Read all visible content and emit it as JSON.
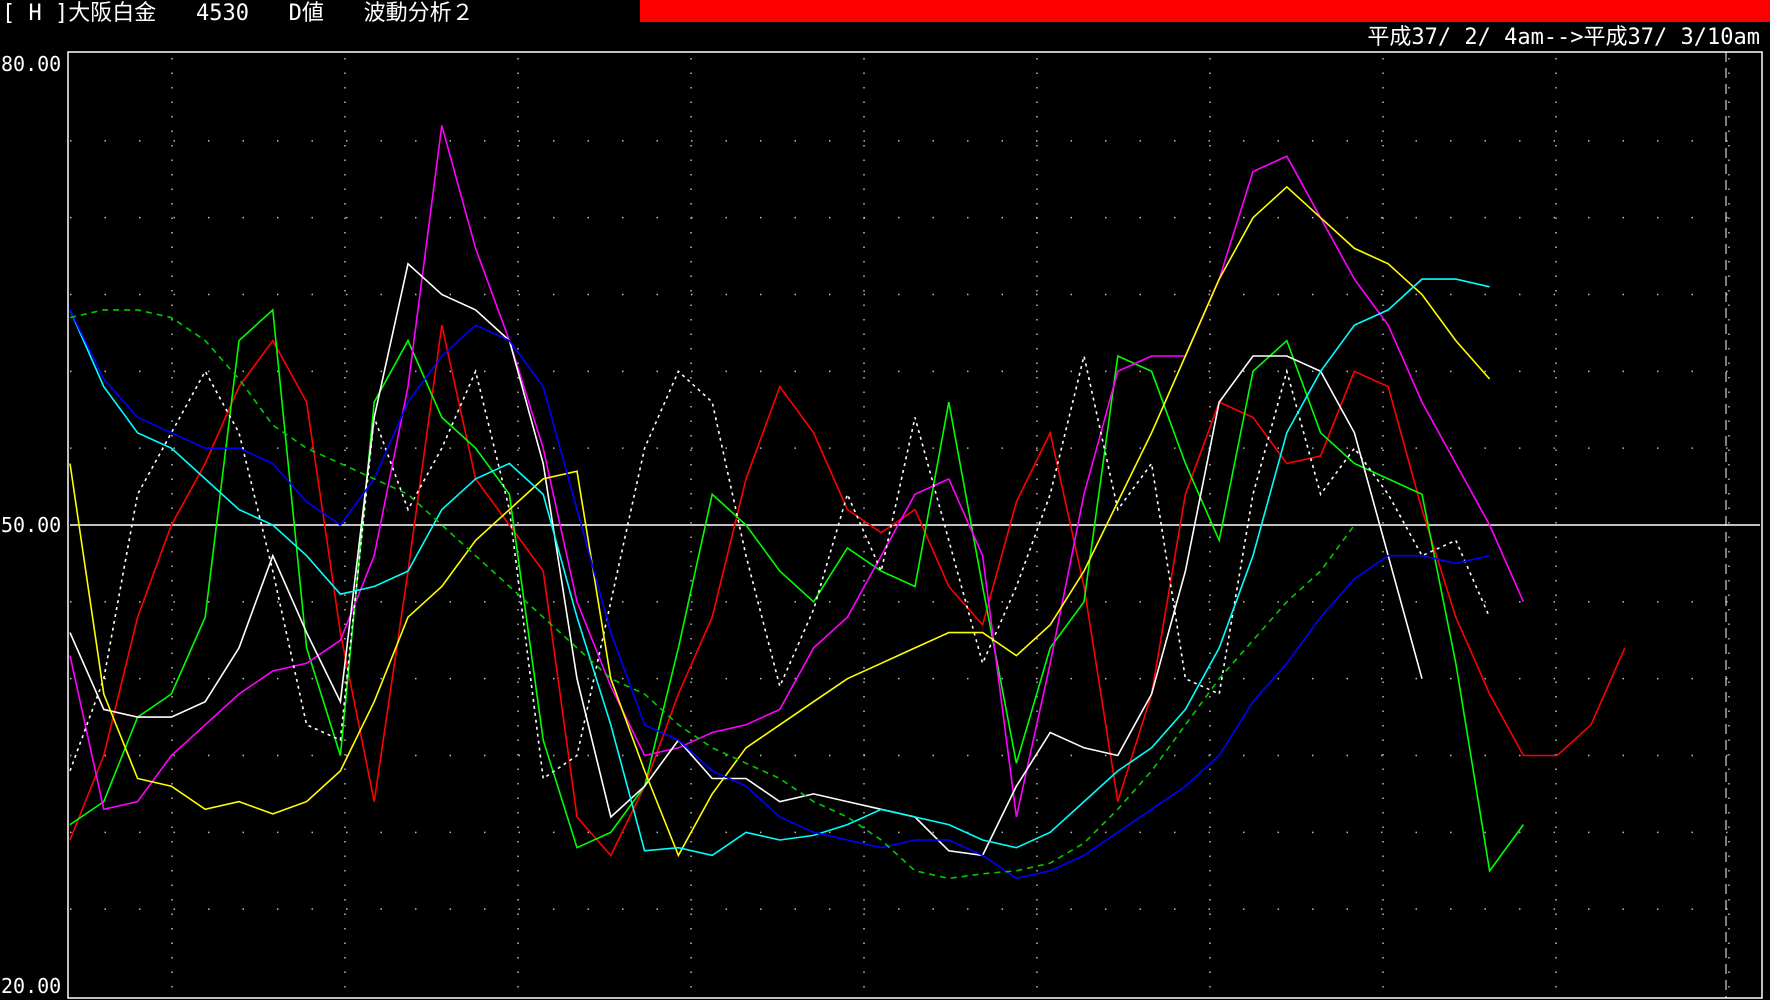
{
  "header": {
    "title": "[ H ]大阪白金   4530   D値   波動分析２",
    "date_range": "平成37/ 2/ 4am-->平成37/ 3/10am",
    "progress_color": "#ff0000"
  },
  "chart_data": {
    "type": "line",
    "title": "",
    "xlabel": "",
    "ylabel": "",
    "ylim": [
      20,
      80
    ],
    "yticks": [
      "80.00",
      "50.00",
      "20.00"
    ],
    "reference_line": 50,
    "grid": true,
    "x": [
      1,
      2,
      3,
      4,
      5,
      6,
      7,
      8,
      9,
      10,
      11,
      12,
      13,
      14,
      15,
      16,
      17,
      18,
      19,
      20,
      21,
      22,
      23,
      24,
      25,
      26,
      27,
      28,
      29,
      30,
      31,
      32,
      33,
      34,
      35,
      36,
      37,
      38,
      39,
      40,
      41,
      42,
      43,
      44,
      45,
      46,
      47,
      48,
      49,
      50,
      51
    ],
    "series": [
      {
        "color": "#ff0000",
        "style": "solid",
        "values": [
          29.5,
          35,
          44,
          50,
          54,
          59,
          62,
          58,
          43,
          32,
          47,
          63,
          53,
          50,
          47,
          31,
          28.5,
          33,
          39,
          44,
          53,
          59,
          56,
          51,
          49.5,
          51,
          46,
          43.5,
          51.5,
          56,
          46,
          32,
          39,
          52,
          58,
          57,
          54,
          54.5,
          60,
          59,
          51,
          44,
          39,
          35,
          35,
          37,
          42,
          null,
          null,
          null,
          null
        ]
      },
      {
        "color": "#00ff00",
        "style": "solid",
        "values": [
          30.5,
          32,
          37.5,
          39,
          44,
          62,
          64,
          42,
          35,
          58,
          62,
          57,
          55,
          52,
          36,
          29,
          30,
          33,
          42,
          52,
          50,
          47,
          45,
          48.5,
          47,
          46,
          58,
          46,
          34.5,
          42,
          45,
          61,
          60,
          54,
          49,
          60,
          62,
          56,
          54,
          53,
          52,
          41,
          27.5,
          30.5,
          null,
          null,
          null,
          null,
          null,
          null,
          null
        ]
      },
      {
        "color": "#ff00ff",
        "style": "solid",
        "values": [
          41.5,
          31.5,
          32,
          35,
          37,
          39,
          40.5,
          41,
          42.5,
          48,
          59,
          76,
          68,
          62,
          55,
          45,
          39.5,
          35,
          35.5,
          36.5,
          37,
          38,
          42,
          44,
          48,
          52,
          53,
          48,
          31,
          41,
          52,
          60,
          61,
          61,
          66,
          73,
          74,
          70,
          66,
          63,
          58,
          54,
          50,
          45,
          null,
          null,
          null,
          null,
          null,
          null,
          null
        ]
      },
      {
        "color": "#ffffff",
        "style": "solid",
        "values": [
          43,
          38,
          37.5,
          37.5,
          38.5,
          42,
          48,
          43,
          38.5,
          57,
          67,
          65,
          64,
          62,
          54,
          40,
          31,
          33,
          36,
          33.5,
          33.5,
          32,
          32.5,
          32,
          31.5,
          31,
          28.8,
          28.5,
          33,
          36.5,
          35.5,
          35,
          39,
          47,
          58,
          61,
          61,
          60,
          56,
          48,
          40,
          null,
          null,
          null,
          null,
          null,
          null,
          null,
          null,
          null,
          null
        ]
      },
      {
        "color": "#ffffff",
        "style": "dotted",
        "values": [
          34,
          40,
          52,
          56,
          60,
          56,
          47,
          37,
          36,
          57,
          51,
          55,
          60,
          51,
          33.5,
          35,
          45,
          55,
          60,
          58,
          48,
          39.5,
          44.5,
          52,
          47,
          57,
          49,
          41,
          46,
          52,
          61,
          51,
          54,
          40,
          39,
          52,
          60,
          52,
          55,
          52,
          48,
          49,
          44,
          null,
          null,
          null,
          null,
          null,
          null,
          null,
          null
        ]
      },
      {
        "color": "#ffff00",
        "style": "solid",
        "values": [
          54,
          39,
          33.5,
          33,
          31.5,
          32,
          31.2,
          32,
          34,
          38.5,
          44,
          46,
          49,
          51,
          53,
          53.5,
          40,
          34,
          28.5,
          32.5,
          35.5,
          37,
          38.5,
          40,
          41,
          42,
          43,
          43,
          41.5,
          43.5,
          47,
          51.5,
          56,
          61,
          66,
          70,
          72,
          70,
          68,
          67,
          65,
          62,
          59.5,
          null,
          null,
          null,
          null,
          null,
          null,
          null,
          null
        ]
      },
      {
        "color": "#00ffff",
        "style": "solid",
        "values": [
          64,
          59,
          56,
          55,
          53,
          51,
          50,
          48,
          45.5,
          46,
          47,
          51,
          53,
          54,
          52,
          44,
          37,
          28.8,
          29,
          28.5,
          30,
          29.5,
          29.8,
          30.5,
          31.5,
          31,
          30.5,
          29.5,
          29,
          30,
          32,
          34,
          35.5,
          38,
          42,
          48,
          56,
          60,
          63,
          64,
          66,
          66,
          65.5,
          null,
          null,
          null,
          null,
          null,
          null,
          null,
          null
        ]
      },
      {
        "color": "#0000ff",
        "style": "solid",
        "values": [
          64,
          59.5,
          57,
          56,
          55,
          55,
          54,
          51.5,
          50,
          53,
          58,
          61,
          63,
          62,
          59,
          51,
          43,
          37,
          36,
          34,
          33,
          31,
          30,
          29.5,
          29,
          29.5,
          29.5,
          28.5,
          27,
          27.5,
          28.5,
          30,
          31.5,
          33,
          35,
          38.5,
          41,
          44,
          46.5,
          48,
          48,
          47.5,
          48,
          null,
          null,
          null,
          null,
          null,
          null,
          null,
          null
        ]
      },
      {
        "color": "#00cc00",
        "style": "dashed",
        "values": [
          63.5,
          64,
          64,
          63.5,
          62,
          59.5,
          56.5,
          55,
          54,
          53,
          52,
          50,
          48,
          46,
          44,
          42,
          40,
          39,
          37,
          35.5,
          34.5,
          33.5,
          32,
          31,
          29.5,
          27.5,
          27,
          27.3,
          27.5,
          28,
          29.3,
          31.5,
          34,
          37,
          40,
          42.5,
          45,
          47,
          50,
          null,
          null,
          null,
          null,
          null,
          null,
          null,
          null,
          null,
          null,
          null,
          null
        ]
      }
    ]
  }
}
